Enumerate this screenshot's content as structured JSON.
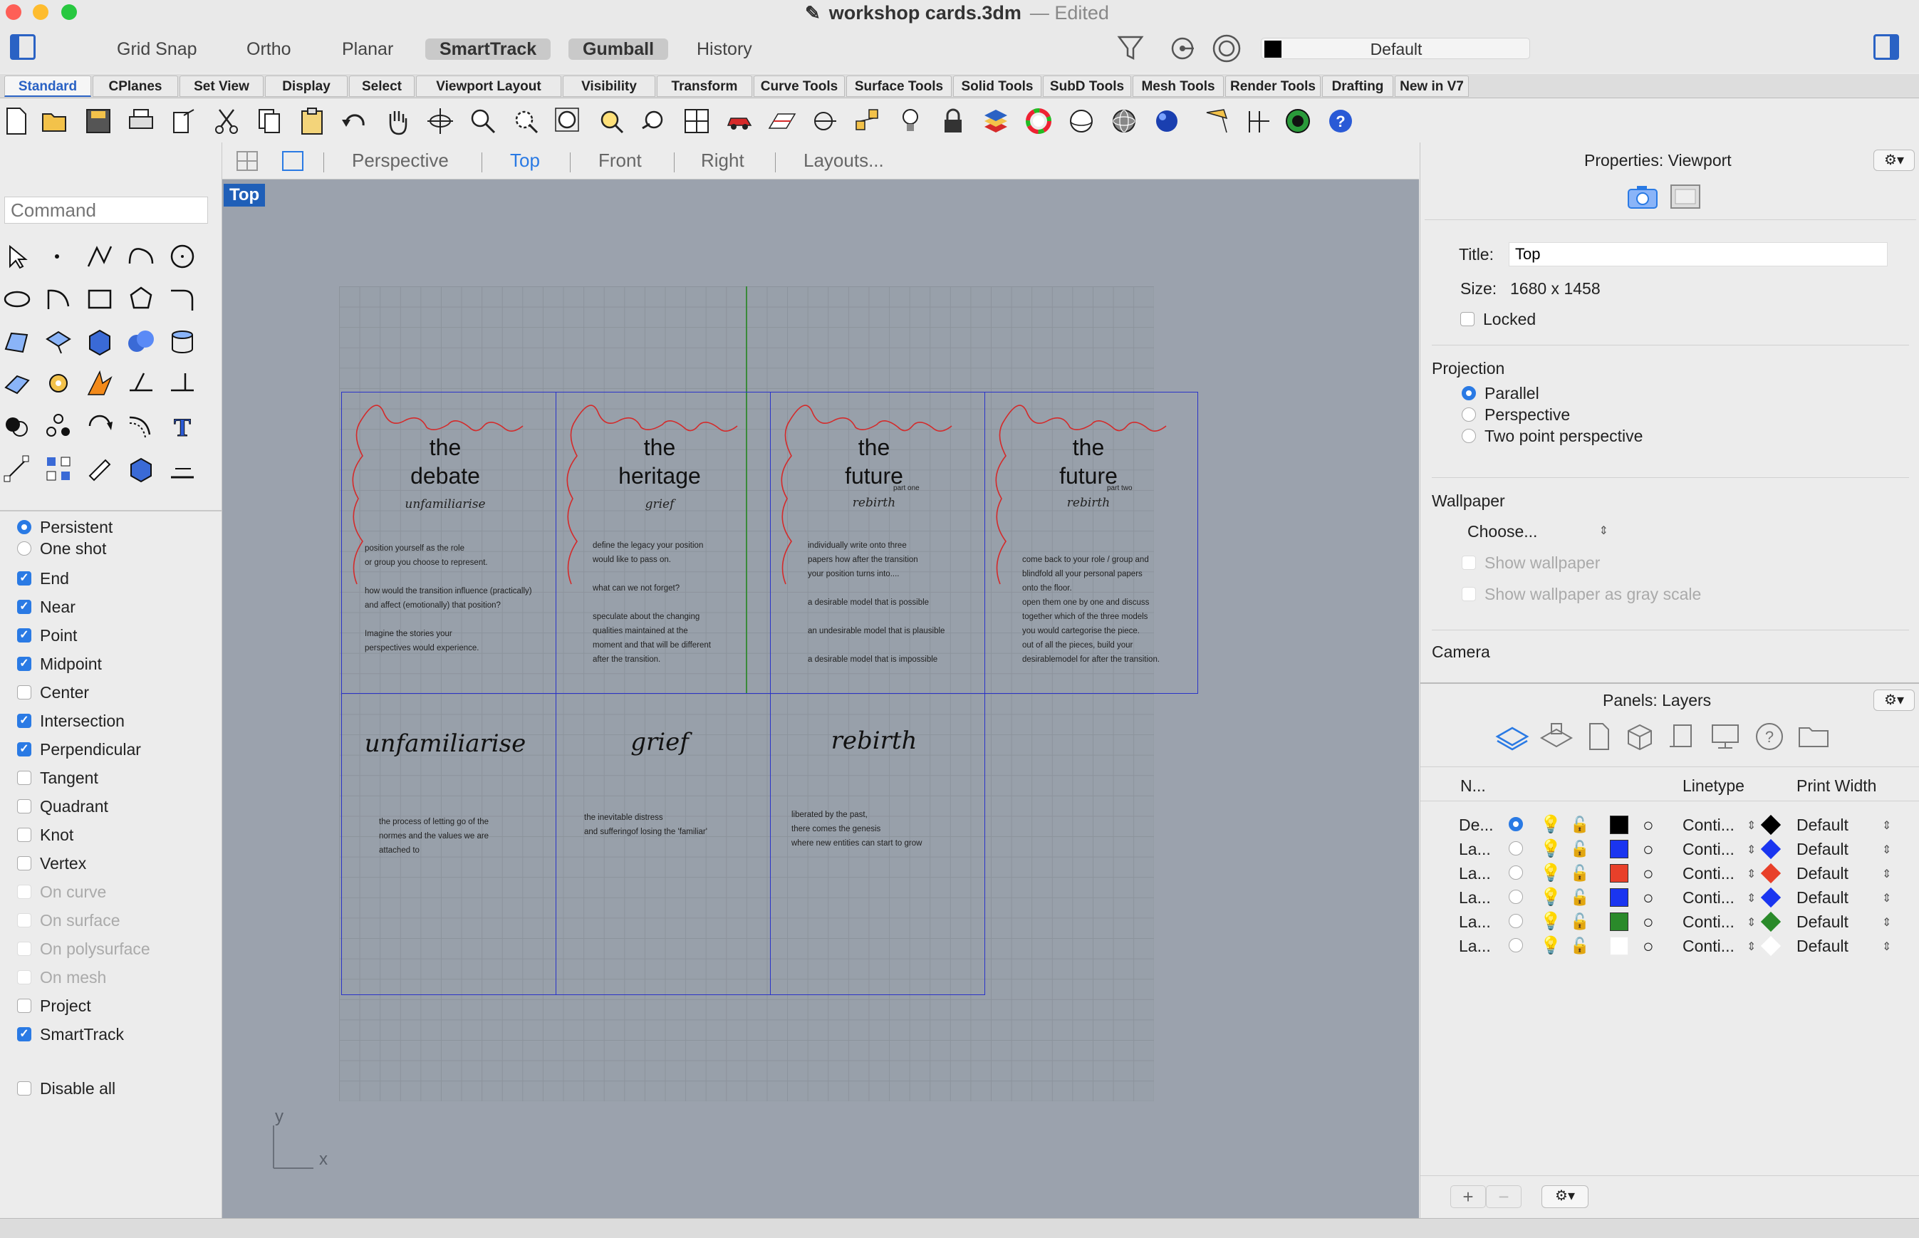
{
  "window": {
    "title": "workshop cards.3dm",
    "status": "— Edited"
  },
  "modes": [
    "Grid Snap",
    "Ortho",
    "Planar",
    "SmartTrack",
    "Gumball",
    "History"
  ],
  "active_modes": [
    "SmartTrack",
    "Gumball"
  ],
  "layer_selector": {
    "value": "Default"
  },
  "tabs": [
    "Standard",
    "CPlanes",
    "Set View",
    "Display",
    "Select",
    "Viewport Layout",
    "Visibility",
    "Transform",
    "Curve Tools",
    "Surface Tools",
    "Solid Tools",
    "SubD Tools",
    "Mesh Tools",
    "Render Tools",
    "Drafting",
    "New in V7"
  ],
  "active_tab": "Standard",
  "command": {
    "placeholder": "Command"
  },
  "osnap": {
    "mode": [
      {
        "label": "Persistent",
        "selected": true
      },
      {
        "label": "One shot",
        "selected": false
      }
    ],
    "items": [
      {
        "label": "End",
        "checked": true,
        "enabled": true
      },
      {
        "label": "Near",
        "checked": true,
        "enabled": true
      },
      {
        "label": "Point",
        "checked": true,
        "enabled": true
      },
      {
        "label": "Midpoint",
        "checked": true,
        "enabled": true
      },
      {
        "label": "Center",
        "checked": false,
        "enabled": true
      },
      {
        "label": "Intersection",
        "checked": true,
        "enabled": true
      },
      {
        "label": "Perpendicular",
        "checked": true,
        "enabled": true
      },
      {
        "label": "Tangent",
        "checked": false,
        "enabled": true
      },
      {
        "label": "Quadrant",
        "checked": false,
        "enabled": true
      },
      {
        "label": "Knot",
        "checked": false,
        "enabled": true
      },
      {
        "label": "Vertex",
        "checked": false,
        "enabled": true
      },
      {
        "label": "On curve",
        "checked": false,
        "enabled": false
      },
      {
        "label": "On surface",
        "checked": false,
        "enabled": false
      },
      {
        "label": "On polysurface",
        "checked": false,
        "enabled": false
      },
      {
        "label": "On mesh",
        "checked": false,
        "enabled": false
      },
      {
        "label": "Project",
        "checked": false,
        "enabled": true
      },
      {
        "label": "SmartTrack",
        "checked": true,
        "enabled": true
      }
    ],
    "disable_all": "Disable all"
  },
  "viewport_tabs": [
    "Perspective",
    "Top",
    "Front",
    "Right",
    "Layouts..."
  ],
  "active_viewport_tab": "Top",
  "viewport": {
    "label": "Top",
    "axis_x": "x",
    "axis_y": "y",
    "cards_top": [
      {
        "title": "the\ndebate",
        "subtitle": "unfamiliarise",
        "part": "",
        "body": "position yourself as the role\nor group you choose to represent.\n\nhow would the transition influence (practically)\nand affect (emotionally) that position?\n\nImagine the stories your\nperspectives would experience."
      },
      {
        "title": "the\nheritage",
        "subtitle": "grief",
        "part": "",
        "body": "define the legacy your position\nwould like to pass on.\n\nwhat can we not forget?\n\nspeculate about the changing\nqualities maintained at the\nmoment and that will be different\nafter the transition."
      },
      {
        "title": "the\nfuture",
        "subtitle": "rebirth",
        "part": "part one",
        "body": "individually write onto three\npapers how after the transition\nyour position turns into....\n\na desirable model that is possible\n\nan undesirable model that is plausible\n\na desirable model that is  impossible"
      },
      {
        "title": "the\nfuture",
        "subtitle": "rebirth",
        "part": "part two",
        "body": "come back to your role / group and\nblindfold all your personal papers\nonto the floor.\nopen them one by one and discuss\ntogether which of the three models\nyou  would cartegorise the piece.\nout of all the pieces, build your\ndesirablemodel for after the transition."
      }
    ],
    "cards_bottom": [
      {
        "title": "unfamiliarise",
        "body": "the process of letting go of the\nnormes  and the values we are\nattached to"
      },
      {
        "title": "grief",
        "body": "the inevitable distress\nand sufferingof losing the 'familiar'"
      },
      {
        "title": "rebirth",
        "body": "liberated by the past,\nthere comes the genesis\nwhere new entities can start to grow"
      }
    ]
  },
  "properties": {
    "header": "Properties: Viewport",
    "title_label": "Title:",
    "title_value": "Top",
    "size_label": "Size:",
    "size_value": "1680 x 1458",
    "locked_label": "Locked",
    "projection_label": "Projection",
    "projection_options": [
      "Parallel",
      "Perspective",
      "Two point perspective"
    ],
    "projection_selected": "Parallel",
    "wallpaper_label": "Wallpaper",
    "wallpaper_choose": "Choose...",
    "show_wallpaper": "Show wallpaper",
    "show_wallpaper_gray": "Show wallpaper as gray scale",
    "camera_label": "Camera"
  },
  "layers": {
    "header": "Panels: Layers",
    "col_name": "N...",
    "col_linetype": "Linetype",
    "col_print_width": "Print Width",
    "rows": [
      {
        "name": "De...",
        "current": true,
        "color": "#000000",
        "linetype": "Conti...",
        "print_color": "#000000",
        "print_width": "Default"
      },
      {
        "name": "La...",
        "current": false,
        "color": "#1a35f0",
        "linetype": "Conti...",
        "print_color": "#1a35f0",
        "print_width": "Default"
      },
      {
        "name": "La...",
        "current": false,
        "color": "#e8402a",
        "linetype": "Conti...",
        "print_color": "#e8402a",
        "print_width": "Default"
      },
      {
        "name": "La...",
        "current": false,
        "color": "#1a35f0",
        "linetype": "Conti...",
        "print_color": "#1a35f0",
        "print_width": "Default"
      },
      {
        "name": "La...",
        "current": false,
        "color": "#2a8a2a",
        "linetype": "Conti...",
        "print_color": "#2a8a2a",
        "print_width": "Default"
      },
      {
        "name": "La...",
        "current": false,
        "color": "#ffffff",
        "linetype": "Conti...",
        "print_color": "#ffffff",
        "print_width": "Default"
      }
    ],
    "add_label": "+",
    "remove_label": "−"
  },
  "colors": {
    "accent": "#2a7ae4",
    "card_border": "#2a33c8",
    "card_curve": "#d42a2a",
    "viewport_bg": "#9ba2ad"
  }
}
